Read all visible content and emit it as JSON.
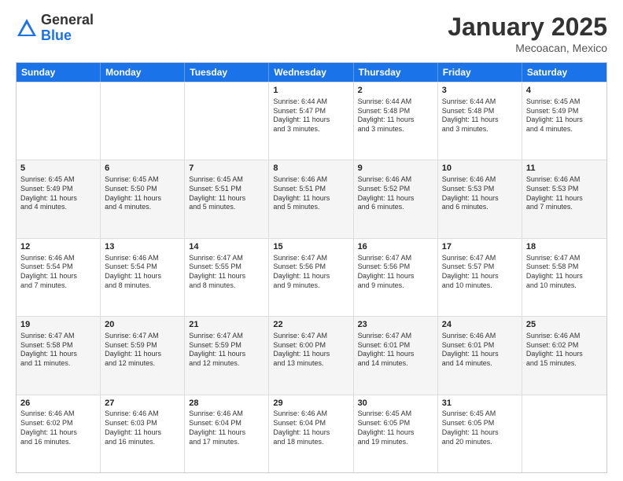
{
  "header": {
    "logo_general": "General",
    "logo_blue": "Blue",
    "month_title": "January 2025",
    "location": "Mecoacan, Mexico"
  },
  "weekdays": [
    "Sunday",
    "Monday",
    "Tuesday",
    "Wednesday",
    "Thursday",
    "Friday",
    "Saturday"
  ],
  "rows": [
    [
      {
        "day": "",
        "text": ""
      },
      {
        "day": "",
        "text": ""
      },
      {
        "day": "",
        "text": ""
      },
      {
        "day": "1",
        "text": "Sunrise: 6:44 AM\nSunset: 5:47 PM\nDaylight: 11 hours\nand 3 minutes."
      },
      {
        "day": "2",
        "text": "Sunrise: 6:44 AM\nSunset: 5:48 PM\nDaylight: 11 hours\nand 3 minutes."
      },
      {
        "day": "3",
        "text": "Sunrise: 6:44 AM\nSunset: 5:48 PM\nDaylight: 11 hours\nand 3 minutes."
      },
      {
        "day": "4",
        "text": "Sunrise: 6:45 AM\nSunset: 5:49 PM\nDaylight: 11 hours\nand 4 minutes."
      }
    ],
    [
      {
        "day": "5",
        "text": "Sunrise: 6:45 AM\nSunset: 5:49 PM\nDaylight: 11 hours\nand 4 minutes."
      },
      {
        "day": "6",
        "text": "Sunrise: 6:45 AM\nSunset: 5:50 PM\nDaylight: 11 hours\nand 4 minutes."
      },
      {
        "day": "7",
        "text": "Sunrise: 6:45 AM\nSunset: 5:51 PM\nDaylight: 11 hours\nand 5 minutes."
      },
      {
        "day": "8",
        "text": "Sunrise: 6:46 AM\nSunset: 5:51 PM\nDaylight: 11 hours\nand 5 minutes."
      },
      {
        "day": "9",
        "text": "Sunrise: 6:46 AM\nSunset: 5:52 PM\nDaylight: 11 hours\nand 6 minutes."
      },
      {
        "day": "10",
        "text": "Sunrise: 6:46 AM\nSunset: 5:53 PM\nDaylight: 11 hours\nand 6 minutes."
      },
      {
        "day": "11",
        "text": "Sunrise: 6:46 AM\nSunset: 5:53 PM\nDaylight: 11 hours\nand 7 minutes."
      }
    ],
    [
      {
        "day": "12",
        "text": "Sunrise: 6:46 AM\nSunset: 5:54 PM\nDaylight: 11 hours\nand 7 minutes."
      },
      {
        "day": "13",
        "text": "Sunrise: 6:46 AM\nSunset: 5:54 PM\nDaylight: 11 hours\nand 8 minutes."
      },
      {
        "day": "14",
        "text": "Sunrise: 6:47 AM\nSunset: 5:55 PM\nDaylight: 11 hours\nand 8 minutes."
      },
      {
        "day": "15",
        "text": "Sunrise: 6:47 AM\nSunset: 5:56 PM\nDaylight: 11 hours\nand 9 minutes."
      },
      {
        "day": "16",
        "text": "Sunrise: 6:47 AM\nSunset: 5:56 PM\nDaylight: 11 hours\nand 9 minutes."
      },
      {
        "day": "17",
        "text": "Sunrise: 6:47 AM\nSunset: 5:57 PM\nDaylight: 11 hours\nand 10 minutes."
      },
      {
        "day": "18",
        "text": "Sunrise: 6:47 AM\nSunset: 5:58 PM\nDaylight: 11 hours\nand 10 minutes."
      }
    ],
    [
      {
        "day": "19",
        "text": "Sunrise: 6:47 AM\nSunset: 5:58 PM\nDaylight: 11 hours\nand 11 minutes."
      },
      {
        "day": "20",
        "text": "Sunrise: 6:47 AM\nSunset: 5:59 PM\nDaylight: 11 hours\nand 12 minutes."
      },
      {
        "day": "21",
        "text": "Sunrise: 6:47 AM\nSunset: 5:59 PM\nDaylight: 11 hours\nand 12 minutes."
      },
      {
        "day": "22",
        "text": "Sunrise: 6:47 AM\nSunset: 6:00 PM\nDaylight: 11 hours\nand 13 minutes."
      },
      {
        "day": "23",
        "text": "Sunrise: 6:47 AM\nSunset: 6:01 PM\nDaylight: 11 hours\nand 14 minutes."
      },
      {
        "day": "24",
        "text": "Sunrise: 6:46 AM\nSunset: 6:01 PM\nDaylight: 11 hours\nand 14 minutes."
      },
      {
        "day": "25",
        "text": "Sunrise: 6:46 AM\nSunset: 6:02 PM\nDaylight: 11 hours\nand 15 minutes."
      }
    ],
    [
      {
        "day": "26",
        "text": "Sunrise: 6:46 AM\nSunset: 6:02 PM\nDaylight: 11 hours\nand 16 minutes."
      },
      {
        "day": "27",
        "text": "Sunrise: 6:46 AM\nSunset: 6:03 PM\nDaylight: 11 hours\nand 16 minutes."
      },
      {
        "day": "28",
        "text": "Sunrise: 6:46 AM\nSunset: 6:04 PM\nDaylight: 11 hours\nand 17 minutes."
      },
      {
        "day": "29",
        "text": "Sunrise: 6:46 AM\nSunset: 6:04 PM\nDaylight: 11 hours\nand 18 minutes."
      },
      {
        "day": "30",
        "text": "Sunrise: 6:45 AM\nSunset: 6:05 PM\nDaylight: 11 hours\nand 19 minutes."
      },
      {
        "day": "31",
        "text": "Sunrise: 6:45 AM\nSunset: 6:05 PM\nDaylight: 11 hours\nand 20 minutes."
      },
      {
        "day": "",
        "text": ""
      }
    ]
  ]
}
